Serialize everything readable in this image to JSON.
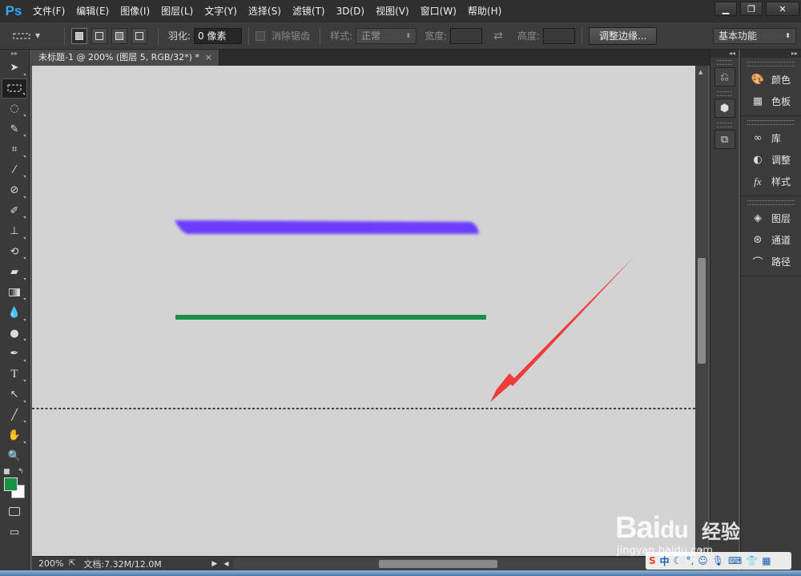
{
  "app": {
    "logo": "Ps"
  },
  "menu": [
    "文件(F)",
    "编辑(E)",
    "图像(I)",
    "图层(L)",
    "文字(Y)",
    "选择(S)",
    "滤镜(T)",
    "3D(D)",
    "视图(V)",
    "窗口(W)",
    "帮助(H)"
  ],
  "window_controls": {
    "minimize": "▁",
    "restore": "❐",
    "close": "✕"
  },
  "options": {
    "feather_label": "羽化:",
    "feather_value": "0 像素",
    "antialias_label": "消除锯齿",
    "style_label": "样式:",
    "style_value": "正常",
    "width_label": "宽度:",
    "height_label": "高度:",
    "refine_edge": "调整边缘...",
    "workspace": "基本功能"
  },
  "document": {
    "tab_title": "未标题-1 @ 200% (图层 5, RGB/32*) *",
    "tab_close": "×"
  },
  "status": {
    "zoom": "200%",
    "doc_info": "文档:7.32M/12.0M"
  },
  "colors": {
    "foreground": "#179345",
    "background": "#ffffff",
    "stroke_magenta": "#e83ad9",
    "stroke_purple": "#6a3cff",
    "stroke_green": "#1b8f43",
    "arrow": "#ef3b3b"
  },
  "panels": {
    "group1": [
      {
        "label": "颜色",
        "icon": "palette-icon"
      },
      {
        "label": "色板",
        "icon": "swatches-icon"
      }
    ],
    "group2": [
      {
        "label": "库",
        "icon": "library-icon"
      },
      {
        "label": "调整",
        "icon": "adjustments-icon"
      },
      {
        "label": "样式",
        "icon": "styles-icon"
      }
    ],
    "group3": [
      {
        "label": "图层",
        "icon": "layers-icon"
      },
      {
        "label": "通道",
        "icon": "channels-icon"
      },
      {
        "label": "路径",
        "icon": "paths-icon"
      }
    ]
  },
  "watermark": {
    "brand": "Bai",
    "brand2": "du",
    "sub": "经验",
    "url": "jingyan.baidu.com"
  },
  "tray": {
    "ime": "中"
  }
}
